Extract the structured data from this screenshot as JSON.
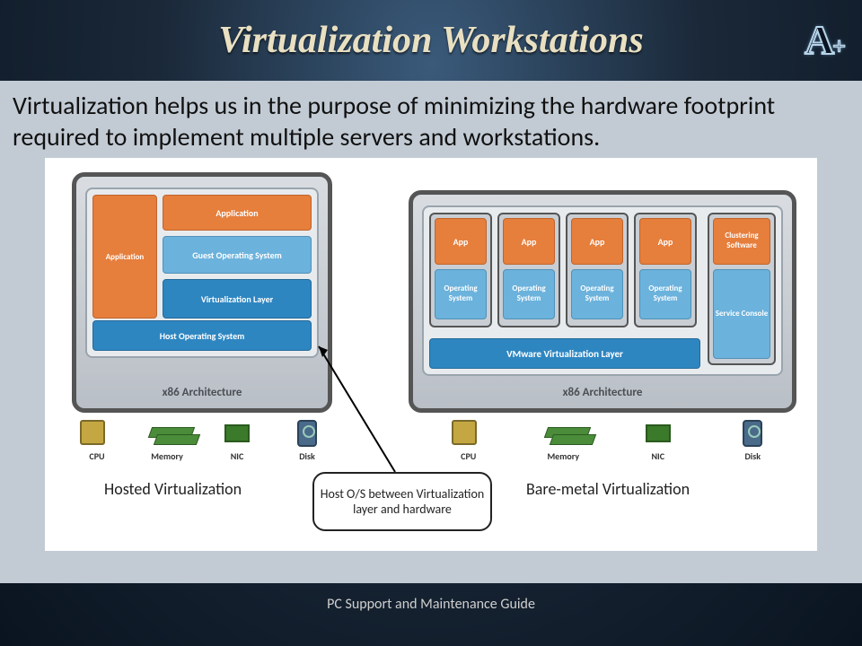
{
  "title": "Virtualization Workstations",
  "logo_main": "A",
  "logo_plus": "+",
  "intro_text": "Virtualization helps us in the purpose of minimizing the hardware footprint required to implement multiple servers and workstations.",
  "footer": "PC Support and Maintenance Guide",
  "diagram": {
    "left": {
      "arch": "x86 Architecture",
      "app_left": "Application",
      "app_top": "Application",
      "guest_os": "Guest Operating System",
      "virt_layer": "Virtualization Layer",
      "host_os": "Host Operating System",
      "caption": "Hosted Virtualization"
    },
    "right": {
      "arch": "x86 Architecture",
      "vm_layer": "VMware Virtualization Layer",
      "vms": [
        {
          "app": "App",
          "os": "Operating System"
        },
        {
          "app": "App",
          "os": "Operating System"
        },
        {
          "app": "App",
          "os": "Operating System"
        },
        {
          "app": "App",
          "os": "Operating System"
        }
      ],
      "side": {
        "top": "Clustering Software",
        "bottom": "Service Console"
      },
      "caption": "Bare-metal Virtualization"
    },
    "hardware": [
      "CPU",
      "Memory",
      "NIC",
      "Disk"
    ],
    "callout": "Host O/S between Virtualization layer and hardware"
  }
}
